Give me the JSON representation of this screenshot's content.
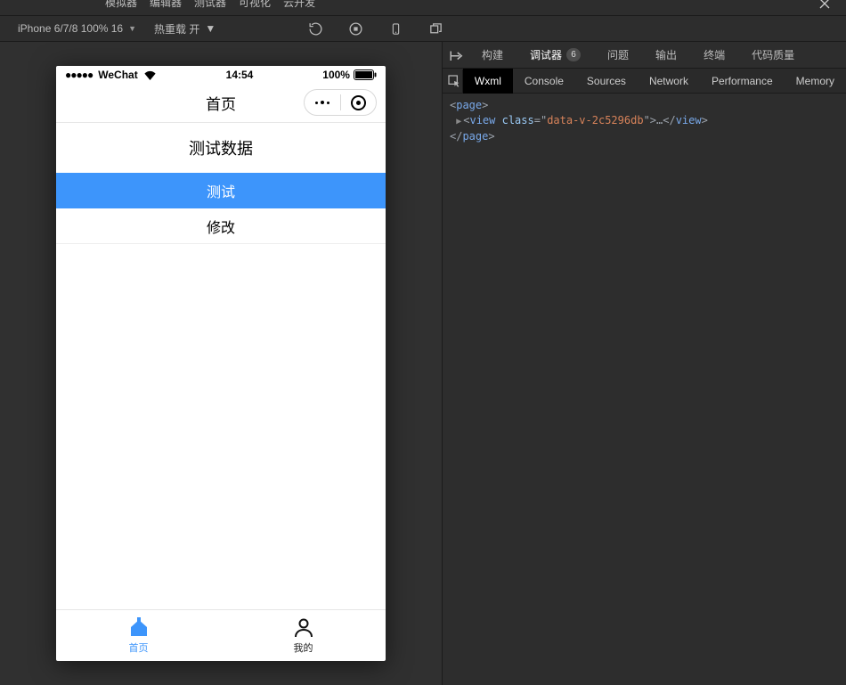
{
  "app_menubar": {
    "items": [
      "模拟器",
      "编辑器",
      "测试器",
      "可视化",
      "云开发"
    ]
  },
  "toolbar": {
    "device_label": "iPhone 6/7/8 100% 16",
    "hot_reload_label": "热重载 开"
  },
  "simulator": {
    "status": {
      "carrier": "WeChat",
      "time": "14:54",
      "battery_pct": "100%"
    },
    "nav_title": "首页",
    "content": {
      "header": "测试数据",
      "primary_button": "测试",
      "default_button": "修改"
    },
    "tabbar": {
      "home": "首页",
      "mine": "我的"
    }
  },
  "right_panel": {
    "tabs": {
      "build": "构建",
      "debugger": "调试器",
      "debugger_badge": "6",
      "problems": "问题",
      "output": "输出",
      "terminal": "终端",
      "quality": "代码质量"
    },
    "devtools_tabs": {
      "wxml": "Wxml",
      "console": "Console",
      "sources": "Sources",
      "network": "Network",
      "performance": "Performance",
      "memory": "Memory"
    },
    "dom": {
      "open_tag": "page",
      "view_prefix": "view",
      "view_attr_name": "class",
      "view_attr_value": "data-v-2c5296db",
      "close_tag": "page"
    }
  }
}
